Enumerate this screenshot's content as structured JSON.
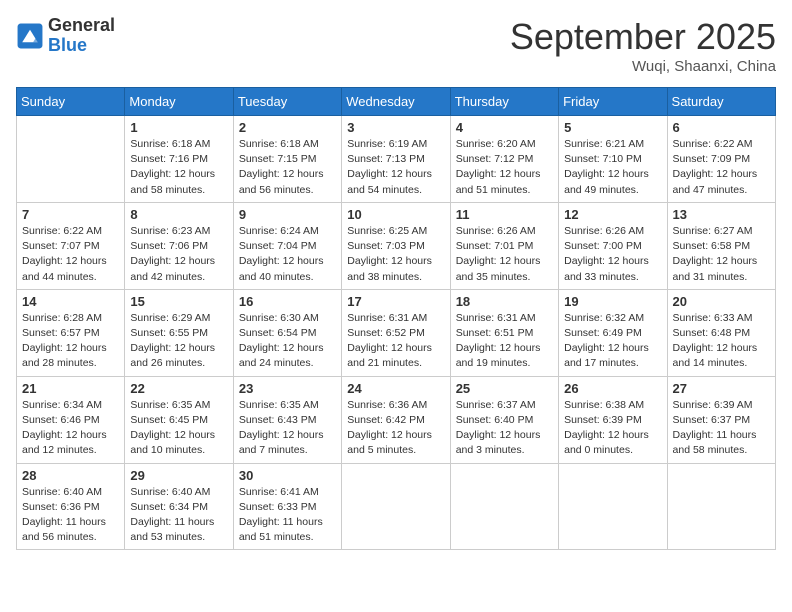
{
  "header": {
    "logo_general": "General",
    "logo_blue": "Blue",
    "month": "September 2025",
    "location": "Wuqi, Shaanxi, China"
  },
  "weekdays": [
    "Sunday",
    "Monday",
    "Tuesday",
    "Wednesday",
    "Thursday",
    "Friday",
    "Saturday"
  ],
  "weeks": [
    [
      {
        "day": "",
        "sunrise": "",
        "sunset": "",
        "daylight": ""
      },
      {
        "day": "1",
        "sunrise": "Sunrise: 6:18 AM",
        "sunset": "Sunset: 7:16 PM",
        "daylight": "Daylight: 12 hours and 58 minutes."
      },
      {
        "day": "2",
        "sunrise": "Sunrise: 6:18 AM",
        "sunset": "Sunset: 7:15 PM",
        "daylight": "Daylight: 12 hours and 56 minutes."
      },
      {
        "day": "3",
        "sunrise": "Sunrise: 6:19 AM",
        "sunset": "Sunset: 7:13 PM",
        "daylight": "Daylight: 12 hours and 54 minutes."
      },
      {
        "day": "4",
        "sunrise": "Sunrise: 6:20 AM",
        "sunset": "Sunset: 7:12 PM",
        "daylight": "Daylight: 12 hours and 51 minutes."
      },
      {
        "day": "5",
        "sunrise": "Sunrise: 6:21 AM",
        "sunset": "Sunset: 7:10 PM",
        "daylight": "Daylight: 12 hours and 49 minutes."
      },
      {
        "day": "6",
        "sunrise": "Sunrise: 6:22 AM",
        "sunset": "Sunset: 7:09 PM",
        "daylight": "Daylight: 12 hours and 47 minutes."
      }
    ],
    [
      {
        "day": "7",
        "sunrise": "Sunrise: 6:22 AM",
        "sunset": "Sunset: 7:07 PM",
        "daylight": "Daylight: 12 hours and 44 minutes."
      },
      {
        "day": "8",
        "sunrise": "Sunrise: 6:23 AM",
        "sunset": "Sunset: 7:06 PM",
        "daylight": "Daylight: 12 hours and 42 minutes."
      },
      {
        "day": "9",
        "sunrise": "Sunrise: 6:24 AM",
        "sunset": "Sunset: 7:04 PM",
        "daylight": "Daylight: 12 hours and 40 minutes."
      },
      {
        "day": "10",
        "sunrise": "Sunrise: 6:25 AM",
        "sunset": "Sunset: 7:03 PM",
        "daylight": "Daylight: 12 hours and 38 minutes."
      },
      {
        "day": "11",
        "sunrise": "Sunrise: 6:26 AM",
        "sunset": "Sunset: 7:01 PM",
        "daylight": "Daylight: 12 hours and 35 minutes."
      },
      {
        "day": "12",
        "sunrise": "Sunrise: 6:26 AM",
        "sunset": "Sunset: 7:00 PM",
        "daylight": "Daylight: 12 hours and 33 minutes."
      },
      {
        "day": "13",
        "sunrise": "Sunrise: 6:27 AM",
        "sunset": "Sunset: 6:58 PM",
        "daylight": "Daylight: 12 hours and 31 minutes."
      }
    ],
    [
      {
        "day": "14",
        "sunrise": "Sunrise: 6:28 AM",
        "sunset": "Sunset: 6:57 PM",
        "daylight": "Daylight: 12 hours and 28 minutes."
      },
      {
        "day": "15",
        "sunrise": "Sunrise: 6:29 AM",
        "sunset": "Sunset: 6:55 PM",
        "daylight": "Daylight: 12 hours and 26 minutes."
      },
      {
        "day": "16",
        "sunrise": "Sunrise: 6:30 AM",
        "sunset": "Sunset: 6:54 PM",
        "daylight": "Daylight: 12 hours and 24 minutes."
      },
      {
        "day": "17",
        "sunrise": "Sunrise: 6:31 AM",
        "sunset": "Sunset: 6:52 PM",
        "daylight": "Daylight: 12 hours and 21 minutes."
      },
      {
        "day": "18",
        "sunrise": "Sunrise: 6:31 AM",
        "sunset": "Sunset: 6:51 PM",
        "daylight": "Daylight: 12 hours and 19 minutes."
      },
      {
        "day": "19",
        "sunrise": "Sunrise: 6:32 AM",
        "sunset": "Sunset: 6:49 PM",
        "daylight": "Daylight: 12 hours and 17 minutes."
      },
      {
        "day": "20",
        "sunrise": "Sunrise: 6:33 AM",
        "sunset": "Sunset: 6:48 PM",
        "daylight": "Daylight: 12 hours and 14 minutes."
      }
    ],
    [
      {
        "day": "21",
        "sunrise": "Sunrise: 6:34 AM",
        "sunset": "Sunset: 6:46 PM",
        "daylight": "Daylight: 12 hours and 12 minutes."
      },
      {
        "day": "22",
        "sunrise": "Sunrise: 6:35 AM",
        "sunset": "Sunset: 6:45 PM",
        "daylight": "Daylight: 12 hours and 10 minutes."
      },
      {
        "day": "23",
        "sunrise": "Sunrise: 6:35 AM",
        "sunset": "Sunset: 6:43 PM",
        "daylight": "Daylight: 12 hours and 7 minutes."
      },
      {
        "day": "24",
        "sunrise": "Sunrise: 6:36 AM",
        "sunset": "Sunset: 6:42 PM",
        "daylight": "Daylight: 12 hours and 5 minutes."
      },
      {
        "day": "25",
        "sunrise": "Sunrise: 6:37 AM",
        "sunset": "Sunset: 6:40 PM",
        "daylight": "Daylight: 12 hours and 3 minutes."
      },
      {
        "day": "26",
        "sunrise": "Sunrise: 6:38 AM",
        "sunset": "Sunset: 6:39 PM",
        "daylight": "Daylight: 12 hours and 0 minutes."
      },
      {
        "day": "27",
        "sunrise": "Sunrise: 6:39 AM",
        "sunset": "Sunset: 6:37 PM",
        "daylight": "Daylight: 11 hours and 58 minutes."
      }
    ],
    [
      {
        "day": "28",
        "sunrise": "Sunrise: 6:40 AM",
        "sunset": "Sunset: 6:36 PM",
        "daylight": "Daylight: 11 hours and 56 minutes."
      },
      {
        "day": "29",
        "sunrise": "Sunrise: 6:40 AM",
        "sunset": "Sunset: 6:34 PM",
        "daylight": "Daylight: 11 hours and 53 minutes."
      },
      {
        "day": "30",
        "sunrise": "Sunrise: 6:41 AM",
        "sunset": "Sunset: 6:33 PM",
        "daylight": "Daylight: 11 hours and 51 minutes."
      },
      {
        "day": "",
        "sunrise": "",
        "sunset": "",
        "daylight": ""
      },
      {
        "day": "",
        "sunrise": "",
        "sunset": "",
        "daylight": ""
      },
      {
        "day": "",
        "sunrise": "",
        "sunset": "",
        "daylight": ""
      },
      {
        "day": "",
        "sunrise": "",
        "sunset": "",
        "daylight": ""
      }
    ]
  ]
}
